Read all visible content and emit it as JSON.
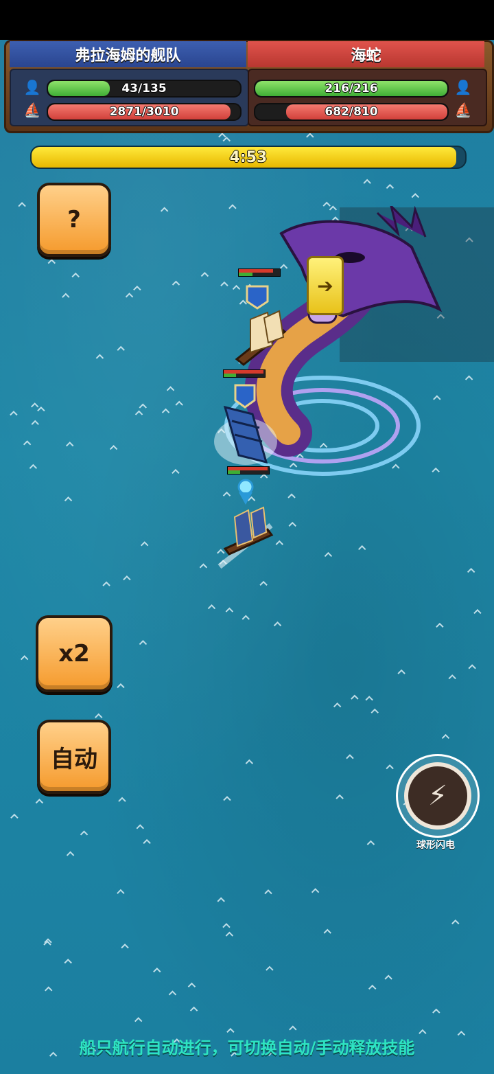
{
  "header": {
    "left_team": "弗拉海姆的舰队",
    "right_team": "海蛇",
    "left_crew": {
      "text": "43/135",
      "fraction": 0.32
    },
    "left_ship": {
      "text": "2871/3010",
      "fraction": 0.95
    },
    "right_crew": {
      "text": "216/216",
      "fraction": 1.0
    },
    "right_ship": {
      "text": "682/810",
      "fraction": 0.84
    }
  },
  "timer": {
    "text": "4:53",
    "fraction": 0.98
  },
  "buttons": {
    "help": "?",
    "speed": "x2",
    "auto": "自动"
  },
  "skill": {
    "label": "球形闪电",
    "icon": "lightning-orb-icon"
  },
  "caption": "船只航行自动进行，可切换自动/手动释放技能",
  "colors": {
    "team_blue": "#3d5fb0",
    "team_red": "#e0534c",
    "bar_green": "#3fae35",
    "bar_red": "#d1403a",
    "timer_yellow": "#ffe93b",
    "button_orange": "#f59a2c",
    "caption_teal": "#2ee4c2"
  }
}
